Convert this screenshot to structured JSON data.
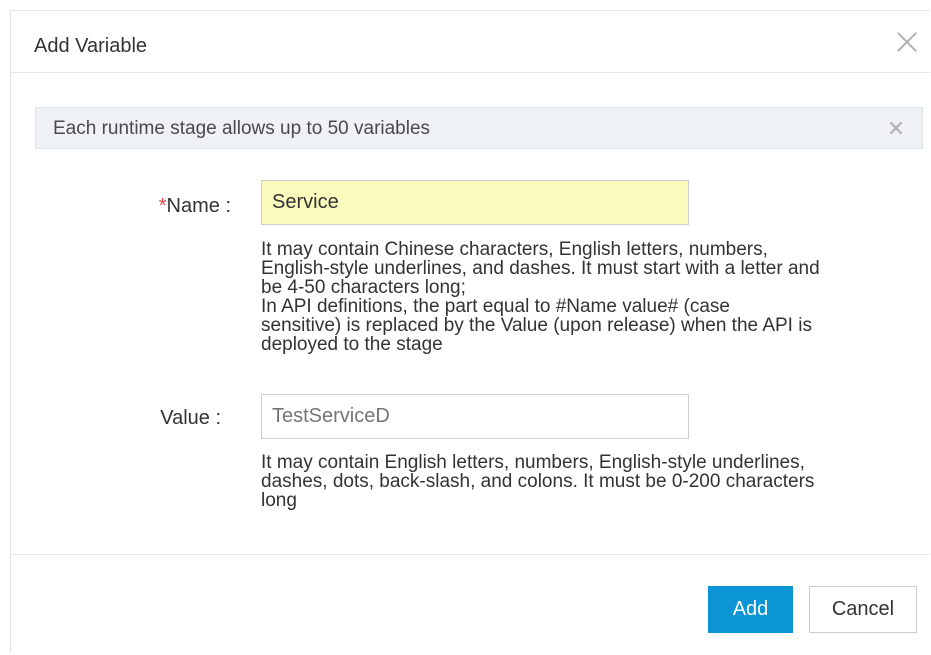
{
  "dialog": {
    "title": "Add Variable",
    "close_icon": "close-icon"
  },
  "notice": {
    "text": "Each runtime stage allows up to 50 variables",
    "close_icon": "close-icon"
  },
  "form": {
    "name": {
      "required_mark": "*",
      "label": "Name :",
      "value": "Service",
      "help_lines": [
        "It may contain Chinese characters, English letters, numbers,",
        "English-style underlines, and dashes. It must start with a letter and",
        "be 4-50 characters long;",
        "In API definitions, the part equal to #Name value# (case",
        "sensitive) is replaced by the Value (upon release) when the API is",
        "deployed to the stage"
      ]
    },
    "value": {
      "label": "Value :",
      "placeholder": "TestServiceD",
      "help_lines": [
        "It may contain English letters, numbers, English-style underlines,",
        "dashes, dots, back-slash, and colons. It must be 0-200 characters",
        "long"
      ]
    }
  },
  "footer": {
    "add_label": "Add",
    "cancel_label": "Cancel"
  },
  "colors": {
    "primary": "#0b95d4",
    "required": "#e54545",
    "name_input_bg": "#fafabd",
    "notice_bg": "#eef1f5"
  }
}
